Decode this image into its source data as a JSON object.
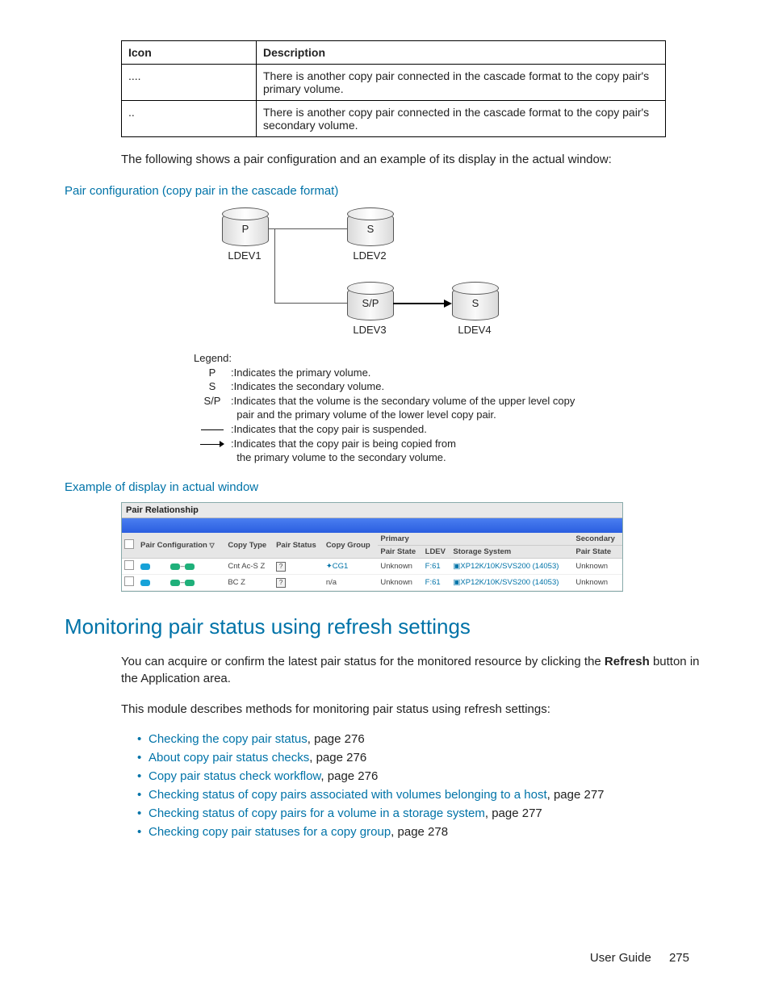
{
  "iconTable": {
    "headers": {
      "c1": "Icon",
      "c2": "Description"
    },
    "rows": [
      {
        "icon": "....",
        "desc": "There is another copy pair connected in the cascade format to the copy pair's primary volume."
      },
      {
        "icon": "..",
        "desc": "There is another copy pair connected in the cascade format to the copy pair's secondary volume."
      }
    ]
  },
  "introPara": "The following shows a pair configuration and an example of its display in the actual window:",
  "pairConfigHeading": "Pair configuration (copy pair in the cascade format)",
  "diagram": {
    "nodes": {
      "n1": {
        "vol": "P",
        "ldev": "LDEV1"
      },
      "n2": {
        "vol": "S",
        "ldev": "LDEV2"
      },
      "n3": {
        "vol": "S/P",
        "ldev": "LDEV3"
      },
      "n4": {
        "vol": "S",
        "ldev": "LDEV4"
      }
    },
    "legendTitle": "Legend:",
    "legend": {
      "p": "Indicates the primary volume.",
      "s": "Indicates the secondary volume.",
      "sp1": "Indicates that the volume is the secondary volume of the upper level copy",
      "sp2": "pair and the primary volume of the lower level copy pair.",
      "line": "Indicates that the copy pair is suspended.",
      "arrow1": "Indicates that the copy pair is being copied from",
      "arrow2": "the primary volume to the secondary volume."
    },
    "legendKeys": {
      "p": "P",
      "s": "S",
      "sp": "S/P",
      "colon": ":"
    }
  },
  "exampleHeading": "Example of display in actual window",
  "pairRel": {
    "title": "Pair Relationship",
    "headers": {
      "chk": "",
      "pc": "Pair Configuration",
      "ct": "Copy Type",
      "ps": "Pair Status",
      "cg": "Copy Group",
      "primary": "Primary",
      "secondary": "Secondary",
      "pstate": "Pair State",
      "ldev": "LDEV",
      "ss": "Storage System",
      "pstate2": "Pair State"
    },
    "rows": [
      {
        "ct": "Cnt Ac-S Z",
        "ps": "?",
        "cg": "CG1",
        "pstate": "Unknown",
        "ldev": "F:61",
        "ss": "XP12K/10K/SVS200 (14053)",
        "pstate2": "Unknown"
      },
      {
        "ct": "BC Z",
        "ps": "?",
        "cg": "n/a",
        "pstate": "Unknown",
        "ldev": "F:61",
        "ss": "XP12K/10K/SVS200 (14053)",
        "pstate2": "Unknown"
      }
    ]
  },
  "sectionTitle": "Monitoring pair status using refresh settings",
  "sectionP1a": "You can acquire or confirm the latest pair status for the monitored resource by clicking the ",
  "sectionP1b": "Refresh",
  "sectionP1c": " button in the Application area.",
  "sectionP2": "This module describes methods for monitoring pair status using refresh settings:",
  "links": [
    {
      "text": "Checking the copy pair status",
      "page": ", page 276"
    },
    {
      "text": "About copy pair status checks",
      "page": ", page 276"
    },
    {
      "text": "Copy pair status check workflow",
      "page": ", page 276"
    },
    {
      "text": "Checking status of copy pairs associated with volumes belonging to a host",
      "page": ", page 277"
    },
    {
      "text": "Checking status of copy pairs for a volume in a storage system",
      "page": ", page 277"
    },
    {
      "text": "Checking copy pair statuses for a copy group",
      "page": ", page 278"
    }
  ],
  "footer": {
    "label": "User Guide",
    "page": "275"
  }
}
